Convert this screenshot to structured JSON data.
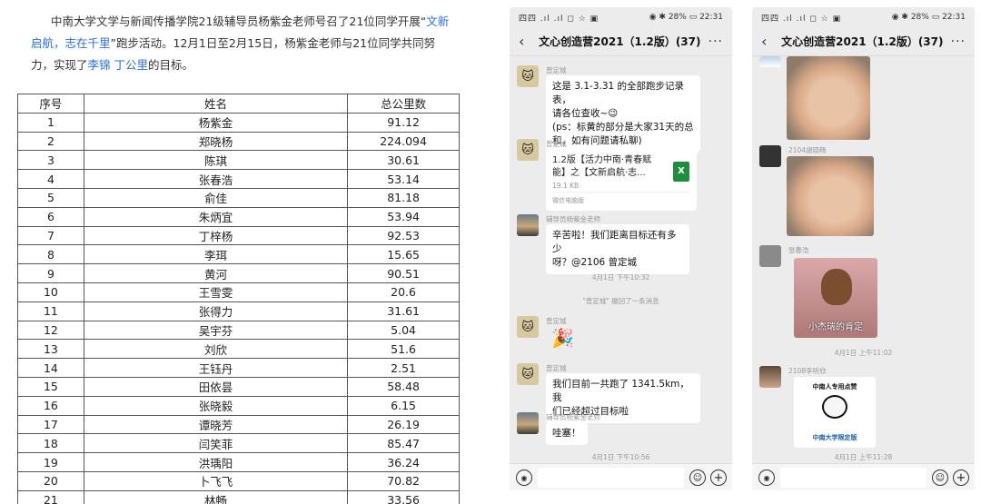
{
  "article": {
    "intro_prefix": "中南大学文学与新闻传播学院21级辅导员杨紫金老师号召了21位同学开展“",
    "intro_link1": "文新启航，志在千里",
    "intro_middle": "”跑步活动。12月1日至2月15日，杨紫金老师与21位同学共同努力，实现了",
    "intro_link2": "李锦",
    "intro_link3": "丁公里",
    "intro_suffix": "的目标。",
    "table": {
      "headers": [
        "序号",
        "姓名",
        "总公里数"
      ],
      "rows": [
        [
          "1",
          "杨紫金",
          "91.12"
        ],
        [
          "2",
          "郑晓杨",
          "224.094"
        ],
        [
          "3",
          "陈琪",
          "30.61"
        ],
        [
          "4",
          "张春浩",
          "53.14"
        ],
        [
          "5",
          "俞佳",
          "81.18"
        ],
        [
          "6",
          "朱炳宜",
          "53.94"
        ],
        [
          "7",
          "丁梓杨",
          "92.53"
        ],
        [
          "8",
          "李珥",
          "15.65"
        ],
        [
          "9",
          "黄河",
          "90.51"
        ],
        [
          "10",
          "王雪雯",
          "20.6"
        ],
        [
          "11",
          "张得力",
          "31.61"
        ],
        [
          "12",
          "吴宇芬",
          "5.04"
        ],
        [
          "13",
          "刘欣",
          "51.6"
        ],
        [
          "14",
          "王钰丹",
          "2.51"
        ],
        [
          "15",
          "田依昙",
          "58.48"
        ],
        [
          "16",
          "张晓毅",
          "6.15"
        ],
        [
          "17",
          "谭晓芳",
          "26.19"
        ],
        [
          "18",
          "闫笑菲",
          "85.47"
        ],
        [
          "19",
          "洪瑀阳",
          "36.24"
        ],
        [
          "20",
          "卜飞飞",
          "70.82"
        ],
        [
          "21",
          "林畅",
          "33.56"
        ]
      ]
    }
  },
  "phone1": {
    "status_left": "四四  .ıl .ıl ◻ ☆ ▣",
    "status_right": "◉ ✱ 28% ▭  22:31",
    "chat_title": "文心创造营2021（1.2版）(37)",
    "messages": {
      "m1_sender": "曾定城",
      "m1_text1": "这是 3.1-3.31 的全部跑步记录表，",
      "m1_text2": "请各位查收~😉",
      "m1_text3": "(ps：标黄的部分是大家31天的总",
      "m1_text4": "和，如有问题请私聊)",
      "m2_sender": "曾定城",
      "m2_file1": "1.2版【活力中南·青春赋",
      "m2_file2": "能】之【文新启航·志...",
      "m2_size": "19.1 KB",
      "m2_src": "微信电脑版",
      "m3_sender": "辅导员杨紫金老师",
      "m3_text1": "辛苦啦！我们距离目标还有多少",
      "m3_text2": "呀？@2106 曾定城",
      "time1": "4月1日 下午10:32",
      "sys": "\"曾定城\" 撤回了一条消息",
      "m4_sender": "曾定城",
      "m5_sender": "曾定城",
      "m5_text1": "我们目前一共跑了 1341.5km，我",
      "m5_text2": "们已经超过目标啦",
      "m6_sender": "辅导员杨紫金老师",
      "m6_text": "哇塞！",
      "time2": "4月1日 下午10:56"
    }
  },
  "phone2": {
    "status_left": "四四  .ıl .ıl ◻ ☆ ▣",
    "status_right": "◉ ✱ 28% ▭  22:31",
    "chat_title": "文心创造营2021（1.2版）(37)",
    "messages": {
      "s1_sender": "2104胡晓畅",
      "s2_sender": "张春浩",
      "jerry_caption": "小杰瑞的肯定",
      "time1": "4月1日 上午11:02",
      "s3_sender": "2108李听欣",
      "panda_top": "中南人专用点赞",
      "panda_bottom": "中南大学限定版",
      "time2": "4月1日 上午11:28"
    }
  },
  "icons": {
    "back": "‹",
    "more": "···",
    "voice": "◉",
    "emoji": "☺",
    "plus": "+"
  }
}
